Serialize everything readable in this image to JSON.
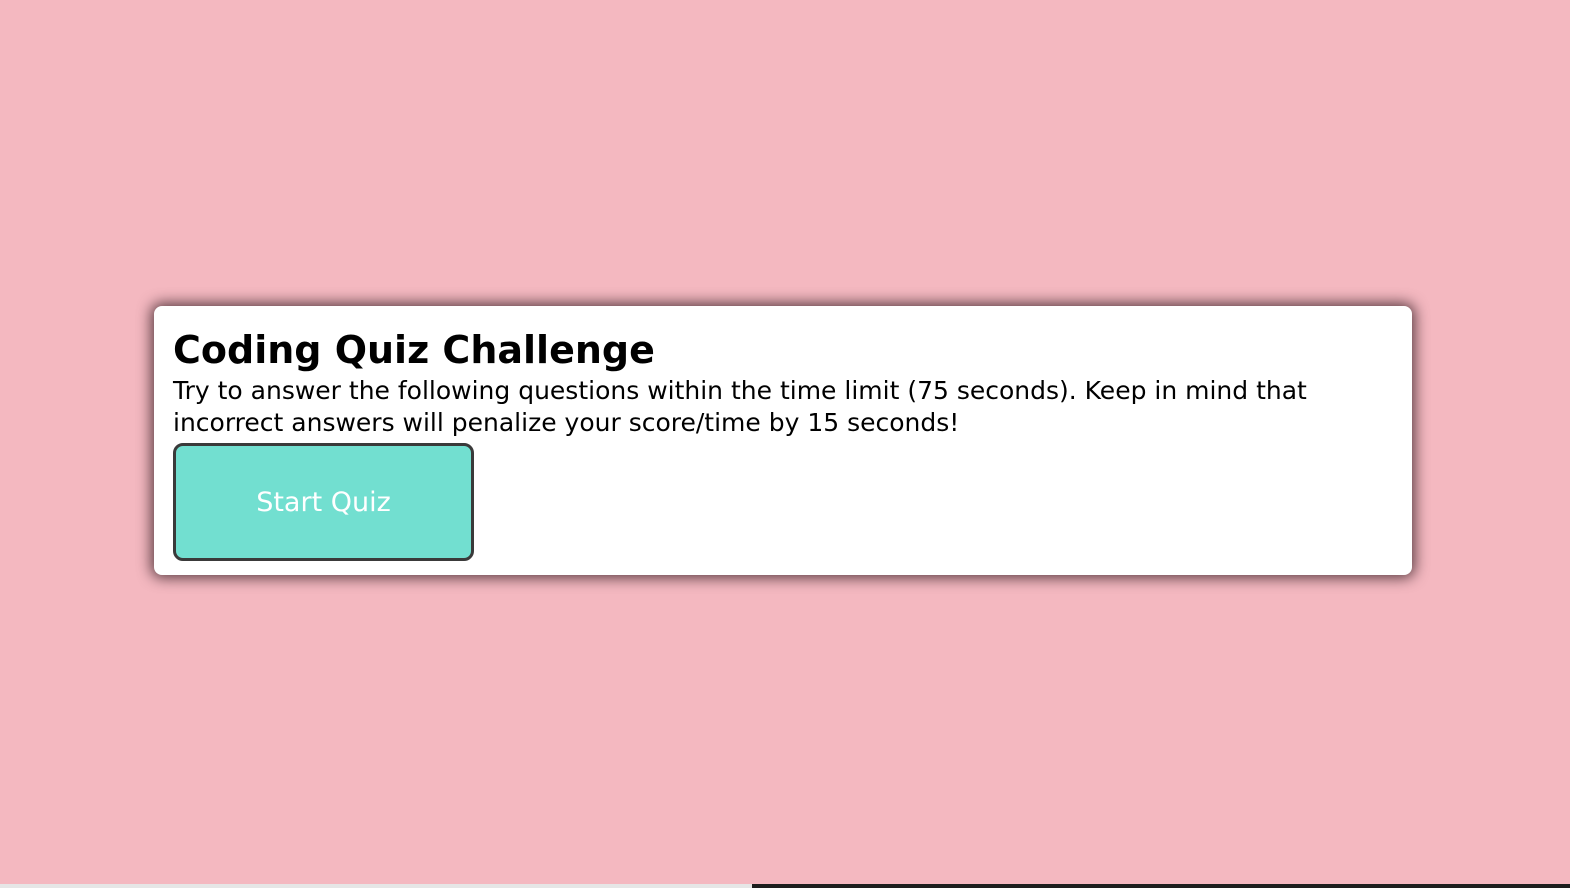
{
  "page": {
    "background_color": "#f4b8c0"
  },
  "quiz_card": {
    "title": "Coding Quiz Challenge",
    "description": "Try to answer the following questions within the time limit (75 seconds). Keep in mind that incorrect answers will penalize your score/time by 15 seconds!",
    "start_button_label": "Start Quiz",
    "button_color": "#72dfd0"
  }
}
